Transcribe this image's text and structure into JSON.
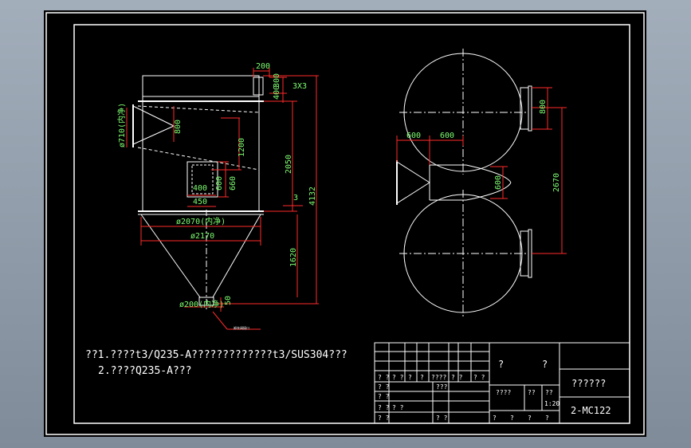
{
  "colors": {
    "frame": "#ffffff",
    "geometry": "#ffffff",
    "dimension": "#ff2a2a",
    "dimension_text": "#7dfc70",
    "screen_bg": "#000000"
  },
  "front_view": {
    "dims": {
      "d200_top": "200",
      "d300": "300",
      "d400_top": "400",
      "d3x3": "3X3",
      "d800": "800",
      "d1200": "1200",
      "d2050": "2050",
      "d4132": "4132",
      "d600_a": "600",
      "d660": "660",
      "d400_b": "400",
      "d450": "450",
      "d3": "3",
      "d710": "ø710(内净)",
      "d2070": "ø2070(内净)",
      "d2170": "ø2170",
      "d1620": "1620",
      "d200_bottom": "ø200(内净)",
      "d50": "50"
    },
    "small_label": "卸灰阀接口"
  },
  "top_view": {
    "dims": {
      "d600_left": "600",
      "d600_mid": "600",
      "d800": "800",
      "d2670": "2670",
      "d600_v": "600"
    }
  },
  "notes": {
    "line1": "??1.????t3/Q235-A?????????????t3/SUS304???",
    "line2": "2.????Q235-A???"
  },
  "title_block": {
    "q1": "?",
    "q2": "?",
    "name": "??????",
    "drawing_no": "2-MC122",
    "r2c1": "? ?",
    "r2c2": "? ?",
    "r2c3": "?",
    "r2c4": "?",
    "r2c5": "????",
    "r2c6": "? ?",
    "r2c7": "? ?",
    "r3c1": "? ?",
    "r3c2": "???",
    "r4c1": "? ?",
    "r5c1": "? ?",
    "r5c2": "? ?",
    "r6c1": "? ?",
    "r6c2": "? ?",
    "mid1": "????",
    "mid2": "??",
    "mid3": "??",
    "scale": "1:20",
    "b1": "?",
    "b2": "?",
    "b3": "?",
    "b4": "?"
  }
}
